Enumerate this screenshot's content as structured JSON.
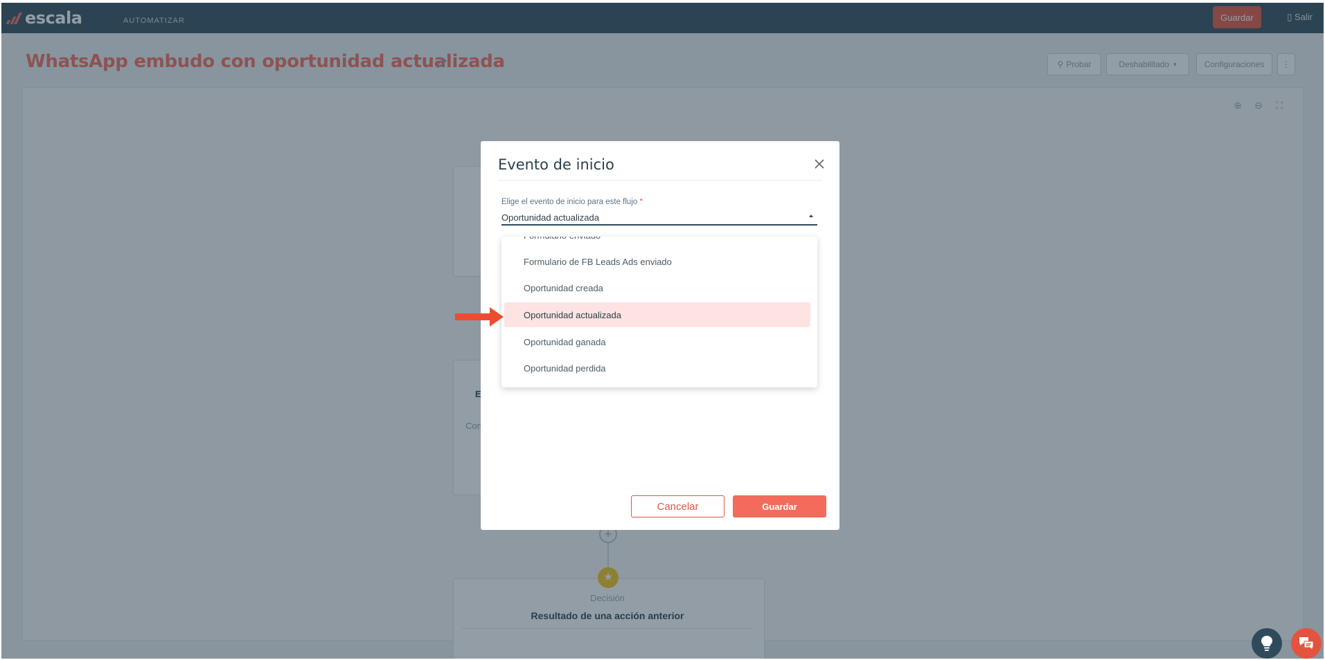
{
  "topbar": {
    "logo": "escala",
    "nav_item": "AUTOMATIZAR",
    "save_label": "Guardar",
    "user_label": "Salir"
  },
  "page": {
    "title": "WhatsApp embudo con oportunidad actualizada",
    "buttons": {
      "test": "Probar",
      "status": "Deshabilitado",
      "settings": "Configuraciones"
    }
  },
  "canvas": {
    "decision_node": {
      "label": "Decisión",
      "title": "Resultado de una acción anterior"
    },
    "fragments": [
      "E",
      "Con"
    ]
  },
  "modal": {
    "title": "Evento de inicio",
    "field_label": "Elige el evento de inicio para este flujo",
    "required_mark": "*",
    "field_value": "Oportunidad actualizada",
    "options": [
      "Formulario enviado",
      "Formulario de FB Leads Ads enviado",
      "Oportunidad creada",
      "Oportunidad actualizada",
      "Oportunidad ganada",
      "Oportunidad perdida"
    ],
    "selected_index": 3,
    "cancel_label": "Cancelar",
    "save_label": "Guardar"
  },
  "colors": {
    "brand": "#f26b5b",
    "topbar": "#2f4a5b",
    "selected_bg": "#fde3e1",
    "arrow": "#ee4b32"
  },
  "icons": [
    "pencil-icon",
    "close-icon",
    "zoom-in-icon",
    "zoom-out-icon",
    "fit-icon",
    "lightbulb-icon",
    "chat-icon",
    "star-icon",
    "plus-icon"
  ]
}
